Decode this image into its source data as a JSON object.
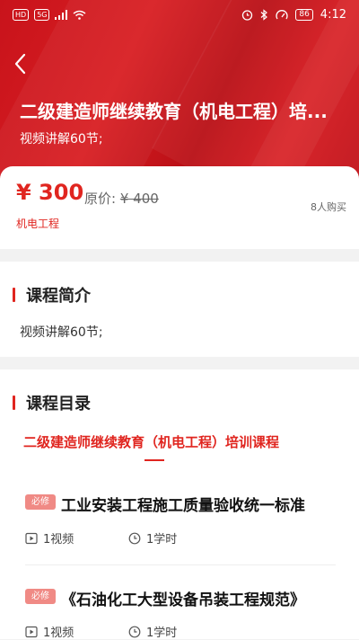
{
  "status_bar": {
    "left_chips": [
      "HD",
      "5G"
    ],
    "time": "4:12",
    "battery": "86"
  },
  "header": {
    "title": "二级建造师继续教育（机电工程）培...",
    "subtitle": "视频讲解60节;"
  },
  "price": {
    "current": "¥ 300",
    "original_label": "原价:",
    "original_value": "¥ 400",
    "buyers": "8人购买",
    "category_tag": "机电工程"
  },
  "intro": {
    "heading": "课程简介",
    "text": "视频讲解60节;"
  },
  "catalog": {
    "heading": "课程目录",
    "course_title": "二级建造师继续教育（机电工程）培训课程",
    "lessons": [
      {
        "badge": "必修",
        "title": "工业安装工程施工质量验收统一标准",
        "videos": "1视频",
        "hours": "1学时"
      },
      {
        "badge": "必修",
        "title": "《石油化工大型设备吊装工程规范》",
        "videos": "1视频",
        "hours": "1学时"
      }
    ]
  },
  "colors": {
    "accent": "#e0251f",
    "hero": "#d0171d",
    "badge": "#f08a85"
  }
}
